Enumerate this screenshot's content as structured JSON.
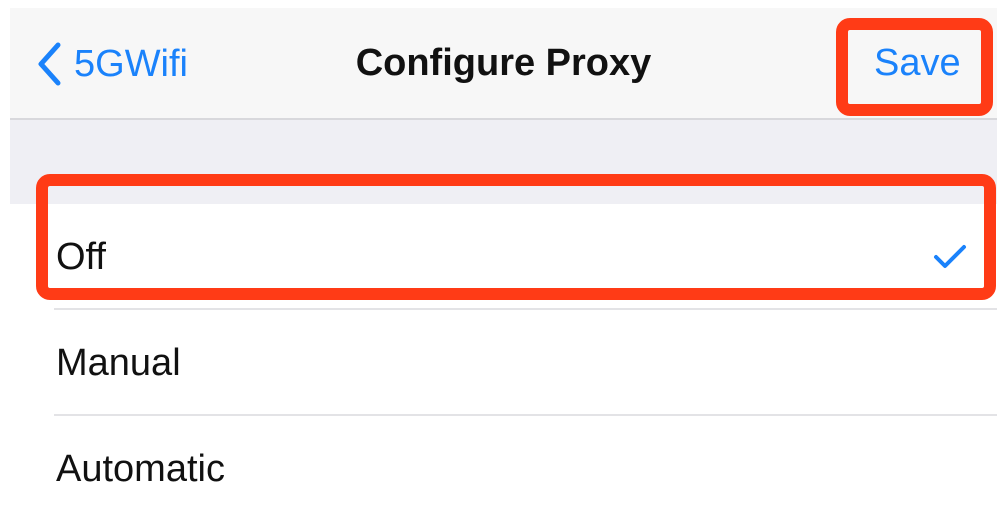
{
  "navbar": {
    "back_label": "5GWifi",
    "title": "Configure Proxy",
    "save_label": "Save"
  },
  "proxy_options": [
    {
      "label": "Off",
      "selected": true
    },
    {
      "label": "Manual",
      "selected": false
    },
    {
      "label": "Automatic",
      "selected": false
    }
  ],
  "colors": {
    "accent": "#1a82fb",
    "highlight": "#ff3b16",
    "group_background": "#efeff4"
  },
  "icons": {
    "back": "chevron-left-icon",
    "selected": "checkmark-icon"
  }
}
